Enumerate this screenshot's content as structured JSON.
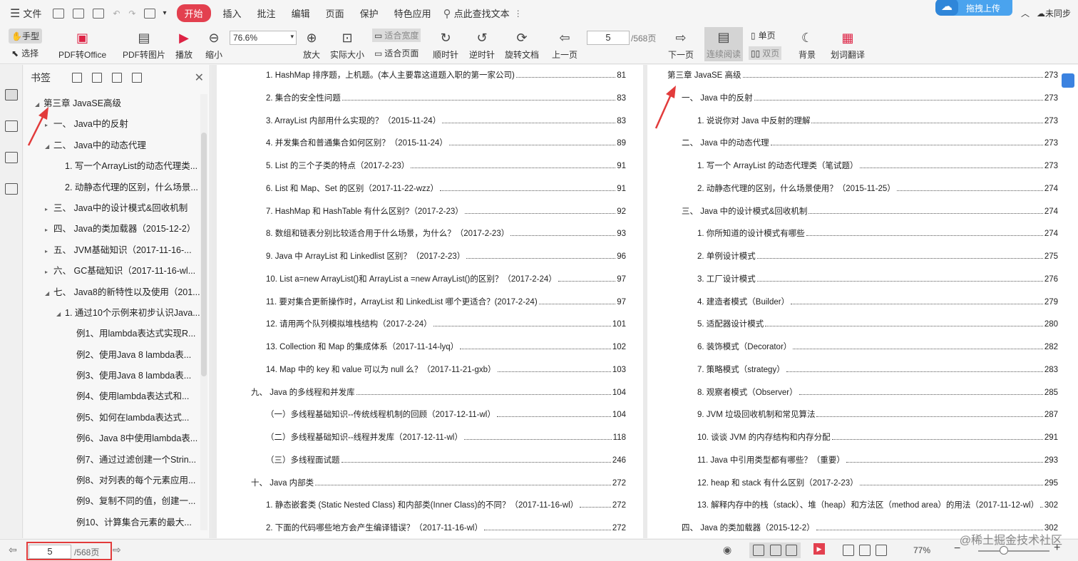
{
  "menubar": {
    "menu_label": "文件",
    "tabs": [
      "开始",
      "插入",
      "批注",
      "编辑",
      "页面",
      "保护",
      "特色应用"
    ],
    "search_text": "点此查找文本",
    "upload_label": "拖拽上传",
    "sync_label": "未同步"
  },
  "toolbar": {
    "hand": "手型",
    "select": "选择",
    "pdf_office": "PDF转Office",
    "pdf_image": "PDF转图片",
    "play": "播放",
    "zoom_out": "缩小",
    "zoom_value": "76.6%",
    "zoom_in": "放大",
    "actual_size": "实际大小",
    "fit_width": "适合宽度",
    "fit_page": "适合页面",
    "rotate_cw": "顺时针",
    "rotate_ccw": "逆时针",
    "rotate_doc": "旋转文档",
    "prev_page": "上一页",
    "page_value": "5",
    "page_total": "/568页",
    "next_page": "下一页",
    "continuous": "连续阅读",
    "single": "单页",
    "double": "双页",
    "background": "背景",
    "translate": "划词翻译"
  },
  "bookmarks": {
    "title": "书签",
    "items": [
      {
        "label": "第三章  JavaSE高级",
        "level": 0,
        "tri": "◢"
      },
      {
        "label": "一、  Java中的反射",
        "level": 1,
        "tri": "▸"
      },
      {
        "label": "二、  Java中的动态代理",
        "level": 1,
        "tri": "◢"
      },
      {
        "label": "1. 写一个ArrayList的动态代理类...",
        "level": 2,
        "tri": ""
      },
      {
        "label": "2. 动静态代理的区别，什么场景...",
        "level": 2,
        "tri": ""
      },
      {
        "label": "三、  Java中的设计模式&回收机制",
        "level": 1,
        "tri": "▸"
      },
      {
        "label": "四、  Java的类加载器（2015-12-2）",
        "level": 1,
        "tri": "▸"
      },
      {
        "label": "五、  JVM基础知识（2017-11-16-...",
        "level": 1,
        "tri": "▸"
      },
      {
        "label": "六、  GC基础知识（2017-11-16-wl...",
        "level": 1,
        "tri": "▸"
      },
      {
        "label": "七、  Java8的新特性以及使用（201...",
        "level": 1,
        "tri": "◢"
      },
      {
        "label": "1. 通过10个示例来初步认识Java...",
        "level": 2,
        "tri": "◢"
      },
      {
        "label": "例1、用lambda表达式实现R...",
        "level": 3,
        "tri": ""
      },
      {
        "label": "例2、使用Java 8 lambda表...",
        "level": 3,
        "tri": ""
      },
      {
        "label": "例3、使用Java 8 lambda表...",
        "level": 3,
        "tri": ""
      },
      {
        "label": "例4、使用lambda表达式和...",
        "level": 3,
        "tri": ""
      },
      {
        "label": "例5、如何在lambda表达式...",
        "level": 3,
        "tri": ""
      },
      {
        "label": "例6、Java 8中使用lambda表...",
        "level": 3,
        "tri": ""
      },
      {
        "label": "例7、通过过滤创建一个Strin...",
        "level": 3,
        "tri": ""
      },
      {
        "label": "例8、对列表的每个元素应用...",
        "level": 3,
        "tri": ""
      },
      {
        "label": "例9、复制不同的值，创建一...",
        "level": 3,
        "tri": ""
      },
      {
        "label": "例10、计算集合元素的最大...",
        "level": 3,
        "tri": ""
      }
    ]
  },
  "left_page": [
    {
      "title": "1. HashMap 排序题，上机题。(本人主要靠这道题入职的第一家公司)",
      "page": "81",
      "indent": 1
    },
    {
      "title": "2.  集合的安全性问题",
      "page": "83",
      "indent": 1
    },
    {
      "title": "3. ArrayList 内部用什么实现的？（2015-11-24）",
      "page": "83",
      "indent": 1
    },
    {
      "title": "4.  并发集合和普通集合如何区别？（2015-11-24）",
      "page": "89",
      "indent": 1
    },
    {
      "title": "5. List 的三个子类的特点（2017-2-23）",
      "page": "91",
      "indent": 1
    },
    {
      "title": "6. List 和 Map、Set 的区别（2017-11-22-wzz）",
      "page": "91",
      "indent": 1
    },
    {
      "title": "7. HashMap 和 HashTable 有什么区别?（2017-2-23）",
      "page": "92",
      "indent": 1
    },
    {
      "title": "8.  数组和链表分别比较适合用于什么场景，为什么？（2017-2-23）",
      "page": "93",
      "indent": 1
    },
    {
      "title": "9. Java 中 ArrayList 和 Linkedlist 区别？（2017-2-23）",
      "page": "96",
      "indent": 1
    },
    {
      "title": "10. List a=new ArrayList()和 ArrayList a =new ArrayList()的区别？（2017-2-24）",
      "page": "97",
      "indent": 1
    },
    {
      "title": "11.  要对集合更新操作时，ArrayList 和 LinkedList 哪个更适合？(2017-2-24)",
      "page": "97",
      "indent": 1
    },
    {
      "title": "12.  请用两个队列模拟堆栈结构（2017-2-24）",
      "page": "101",
      "indent": 1
    },
    {
      "title": "13. Collection 和 Map 的集成体系（2017-11-14-lyq）",
      "page": "102",
      "indent": 1
    },
    {
      "title": "14. Map 中的 key 和 value 可以为 null 么？（2017-11-21-gxb）",
      "page": "103",
      "indent": 1
    },
    {
      "title": "九、  Java 的多线程和并发库",
      "page": "104",
      "indent": 0
    },
    {
      "title": "（一）多线程基础知识--传统线程机制的回顾（2017-12-11-wl）",
      "page": "104",
      "indent": 1
    },
    {
      "title": "（二）多线程基础知识--线程并发库（2017-12-11-wl）",
      "page": "118",
      "indent": 1
    },
    {
      "title": "（三）多线程面试题",
      "page": "246",
      "indent": 1
    },
    {
      "title": "十、  Java 内部类",
      "page": "272",
      "indent": 0
    },
    {
      "title": "1.  静态嵌套类 (Static Nested Class) 和内部类(Inner Class)的不同？（2017-11-16-wl）",
      "page": "272",
      "indent": 1
    },
    {
      "title": "2.  下面的代码哪些地方会产生编译错误？（2017-11-16-wl）",
      "page": "272",
      "indent": 1
    }
  ],
  "right_page": [
    {
      "title": "第三章  JavaSE 高级",
      "page": "273",
      "indent": 0
    },
    {
      "title": "一、  Java 中的反射",
      "page": "273",
      "indent": 1
    },
    {
      "title": "1.  说说你对 Java 中反射的理解",
      "page": "273",
      "indent": 2
    },
    {
      "title": "二、  Java 中的动态代理",
      "page": "273",
      "indent": 1
    },
    {
      "title": "1.  写一个 ArrayList 的动态代理类（笔试题）",
      "page": "273",
      "indent": 2
    },
    {
      "title": "2.  动静态代理的区别，什么场景使用？（2015-11-25）",
      "page": "274",
      "indent": 2
    },
    {
      "title": "三、  Java 中的设计模式&回收机制",
      "page": "274",
      "indent": 1
    },
    {
      "title": "1.  你所知道的设计模式有哪些",
      "page": "274",
      "indent": 2
    },
    {
      "title": "2.  单例设计模式",
      "page": "275",
      "indent": 2
    },
    {
      "title": "3.  工厂设计模式",
      "page": "276",
      "indent": 2
    },
    {
      "title": "4.  建造者模式（Builder）",
      "page": "279",
      "indent": 2
    },
    {
      "title": "5.  适配器设计模式",
      "page": "280",
      "indent": 2
    },
    {
      "title": "6.  装饰模式（Decorator）",
      "page": "282",
      "indent": 2
    },
    {
      "title": "7.  策略模式（strategy）",
      "page": "283",
      "indent": 2
    },
    {
      "title": "8.  观察者模式（Observer）",
      "page": "285",
      "indent": 2
    },
    {
      "title": "9. JVM 垃圾回收机制和常见算法",
      "page": "287",
      "indent": 2
    },
    {
      "title": "10.  谈谈 JVM 的内存结构和内存分配",
      "page": "291",
      "indent": 2
    },
    {
      "title": "11. Java 中引用类型都有哪些？（重要）",
      "page": "293",
      "indent": 2
    },
    {
      "title": "12. heap 和 stack 有什么区别（2017-2-23）",
      "page": "295",
      "indent": 2
    },
    {
      "title": "13.  解释内存中的栈（stack）、堆（heap）和方法区（method area）的用法（2017-11-12-wl）",
      "page": "302",
      "indent": 2
    },
    {
      "title": "四、  Java 的类加载器（2015-12-2）",
      "page": "302",
      "indent": 1
    }
  ],
  "status": {
    "page_value": "5",
    "page_total": "/568页",
    "zoom": "77%",
    "watermark": "@稀土掘金技术社区"
  },
  "colors": {
    "accent": "#e3404f",
    "annotation": "#e23b3b"
  }
}
